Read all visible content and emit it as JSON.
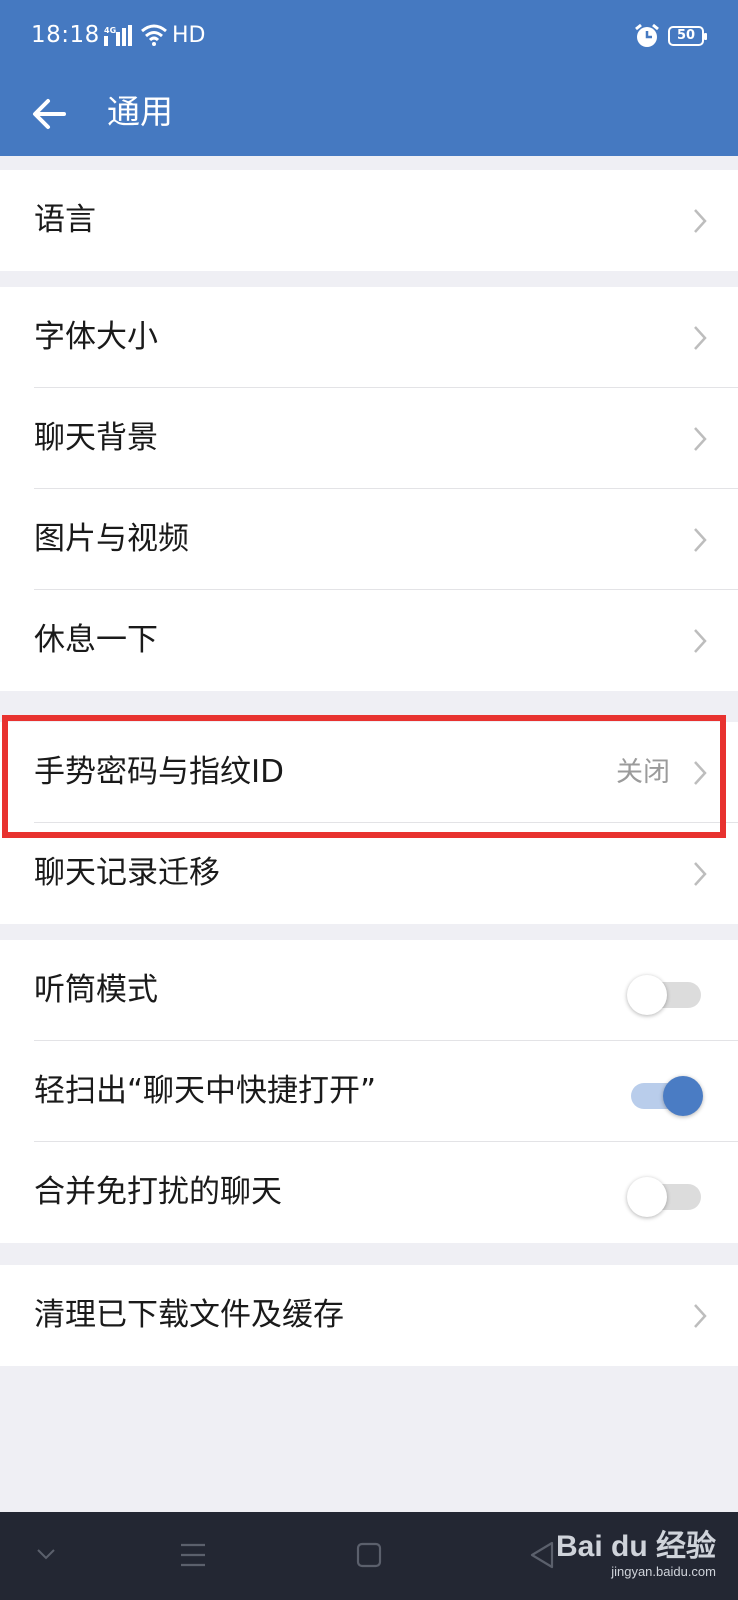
{
  "status_bar": {
    "time": "18:18",
    "network": "4G",
    "hd": "HD",
    "battery": "50"
  },
  "header": {
    "title": "通用"
  },
  "groups": [
    {
      "items": [
        {
          "label": "语言"
        }
      ]
    },
    {
      "items": [
        {
          "label": "字体大小"
        },
        {
          "label": "聊天背景"
        },
        {
          "label": "图片与视频"
        },
        {
          "label": "休息一下"
        }
      ]
    },
    {
      "items": [
        {
          "label": "手势密码与指纹ID",
          "value": "关闭"
        },
        {
          "label": "聊天记录迁移"
        }
      ]
    },
    {
      "items": [
        {
          "label": "听筒模式",
          "toggle": false
        },
        {
          "label": "轻扫出“聊天中快捷打开”",
          "toggle": true
        },
        {
          "label": "合并免打扰的聊天",
          "toggle": false
        }
      ]
    },
    {
      "items": [
        {
          "label": "清理已下载文件及缓存"
        }
      ]
    }
  ],
  "watermark": {
    "logo": "Bai du 经验",
    "url": "jingyan.baidu.com"
  },
  "colors": {
    "primary": "#4579c1",
    "highlight": "#e8322f",
    "toggle_on": "#4a7cc4"
  }
}
